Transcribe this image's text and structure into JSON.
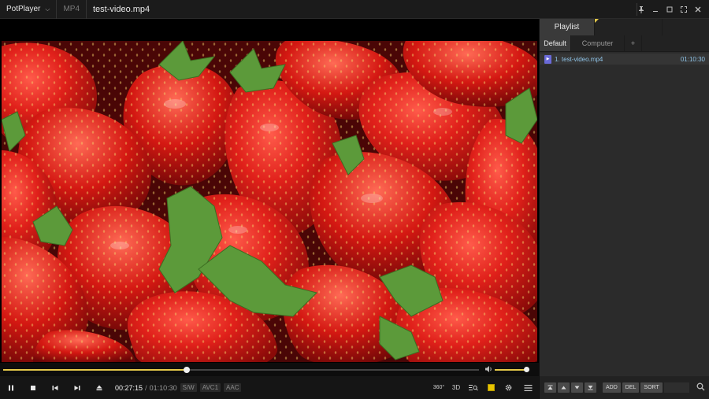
{
  "app": {
    "menu_label": "PotPlayer",
    "format": "MP4",
    "title": "test-video.mp4"
  },
  "window_controls": [
    "pin-icon",
    "minimize-icon",
    "maximize-icon",
    "fullscreen-icon",
    "close-icon"
  ],
  "playback": {
    "current_time": "00:27:15",
    "separator": "/",
    "total_time": "01:10:30",
    "progress_fraction": 0.386,
    "volume_fraction": 0.9,
    "tags": [
      "S/W",
      "AVC1",
      "AAC"
    ]
  },
  "controls": {
    "labels_360": "360°",
    "labels_3d": "3D"
  },
  "playlist": {
    "header": "Playlist",
    "tabs": [
      "Default",
      "Computer",
      "+"
    ],
    "items": [
      {
        "name": "1. test-video.mp4",
        "duration": "01:10:30"
      }
    ],
    "footer_buttons": [
      "ADD",
      "DEL",
      "SORT"
    ]
  },
  "colors": {
    "accent": "#e5c94a",
    "playlist_text": "#8fc4e8"
  }
}
